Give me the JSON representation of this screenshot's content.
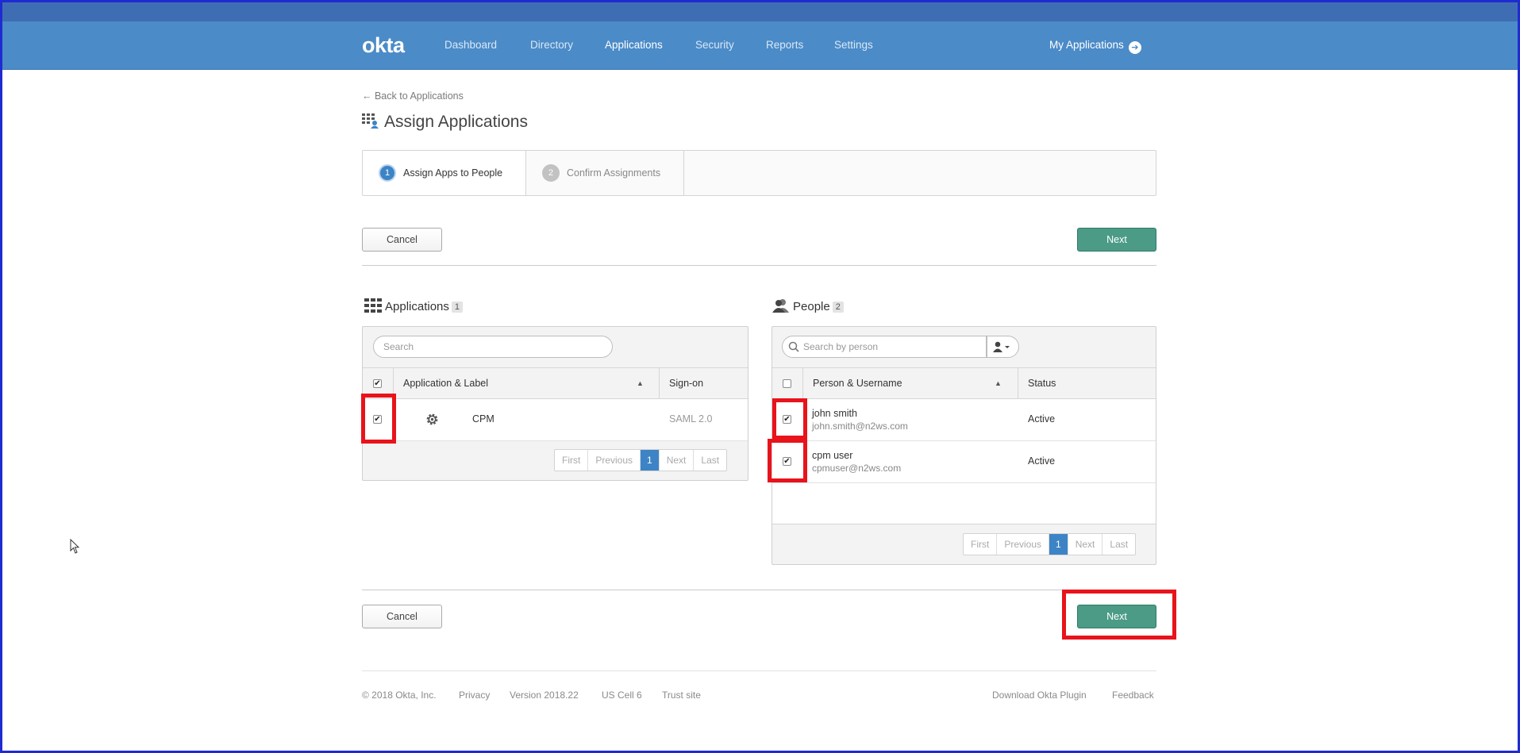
{
  "navbar": {
    "logo": "okta",
    "items": [
      "Dashboard",
      "Directory",
      "Applications",
      "Security",
      "Reports",
      "Settings"
    ],
    "active": "Applications",
    "my_applications": "My Applications"
  },
  "page": {
    "back_link": "← Back to Applications",
    "title": "Assign Applications"
  },
  "wizard": {
    "steps": [
      {
        "num": "1",
        "label": "Assign Apps to People"
      },
      {
        "num": "2",
        "label": "Confirm Assignments"
      }
    ]
  },
  "buttons": {
    "cancel": "Cancel",
    "next": "Next"
  },
  "applications": {
    "title": "Applications",
    "count": "1",
    "search_placeholder": "Search",
    "columns": [
      "Application & Label",
      "Sign-on"
    ],
    "rows": [
      {
        "label": "CPM",
        "signon": "SAML 2.0",
        "checked": true
      }
    ],
    "pager": [
      "First",
      "Previous",
      "1",
      "Next",
      "Last"
    ]
  },
  "people": {
    "title": "People",
    "count": "2",
    "search_placeholder": "Search by person",
    "columns": [
      "Person & Username",
      "Status"
    ],
    "rows": [
      {
        "name": "john smith",
        "username": "john.smith@n2ws.com",
        "status": "Active",
        "checked": true
      },
      {
        "name": "cpm user",
        "username": "cpmuser@n2ws.com",
        "status": "Active",
        "checked": true
      }
    ],
    "pager": [
      "First",
      "Previous",
      "1",
      "Next",
      "Last"
    ]
  },
  "footer": {
    "copyright": "© 2018 Okta, Inc.",
    "privacy": "Privacy",
    "version": "Version 2018.22",
    "cell": "US Cell 6",
    "trust": "Trust site",
    "download_plugin": "Download Okta Plugin",
    "feedback": "Feedback"
  },
  "colors": {
    "navbar": "#4b8bc8",
    "primary_button": "#4b9b86",
    "highlight": "#e8131b",
    "active_page": "#3d84c6"
  }
}
